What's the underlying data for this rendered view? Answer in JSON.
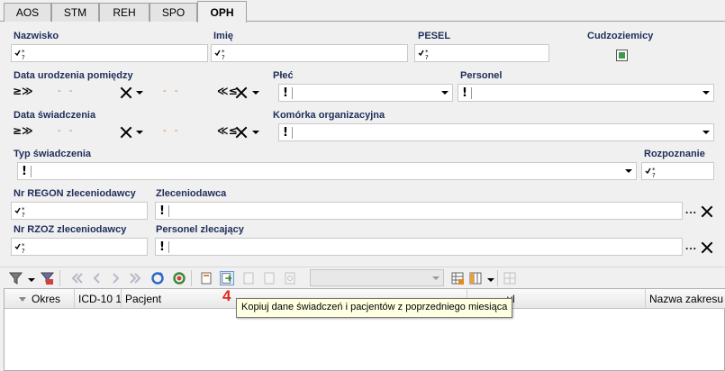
{
  "tabs": [
    {
      "label": "AOS"
    },
    {
      "label": "STM"
    },
    {
      "label": "REH"
    },
    {
      "label": "SPO"
    },
    {
      "label": "OPH"
    }
  ],
  "active_tab": "OPH",
  "form": {
    "nazwisko": {
      "label": "Nazwisko"
    },
    "imie": {
      "label": "Imię"
    },
    "pesel": {
      "label": "PESEL"
    },
    "cudzoziemcy": {
      "label": "Cudzoziemicy",
      "checked": true
    },
    "data_urodzenia": {
      "label": "Data urodzenia pomiędzy",
      "from": "- -",
      "to": "- -"
    },
    "plec": {
      "label": "Płeć"
    },
    "personel": {
      "label": "Personel"
    },
    "data_swiadczenia": {
      "label": "Data świadczenia",
      "from": "- -",
      "to": "- -"
    },
    "komorka": {
      "label": "Komórka organizacyjna"
    },
    "typ_swiadczenia": {
      "label": "Typ świadczenia"
    },
    "rozpoznanie": {
      "label": "Rozpoznanie"
    },
    "nr_regon": {
      "label": "Nr REGON zleceniodawcy"
    },
    "zleceniodawca": {
      "label": "Zleceniodawca",
      "button": "..."
    },
    "nr_rzoz": {
      "label": "Nr RZOZ zleceniodawcy"
    },
    "personel_zlecajacy": {
      "label": "Personel zlecający",
      "button": "..."
    }
  },
  "toolbar": {
    "step_number": "4",
    "tooltip": "Kopiuj dane świadczeń i pacjentów z poprzedniego miesiąca",
    "icons": [
      "filter-icon",
      "clear-filter-icon",
      "first-icon",
      "prev-icon",
      "next-icon",
      "last-icon",
      "refresh-icon",
      "sync-icon",
      "new-doc-icon",
      "copy-data-icon",
      "edit-icon",
      "delete-icon",
      "preview-icon",
      "grid-config-icon",
      "columns-icon",
      "export-icon"
    ]
  },
  "grid": {
    "columns": [
      "Okres",
      "ICD-10 1",
      "Pacjent",
      "Nazwa zakresu"
    ],
    "hidden_partial": "yl"
  },
  "colors": {
    "label": "#1f2e5a",
    "date_dash": "#e07a2c",
    "step": "#e0281e",
    "tooltip_bg": "#ffffe1"
  }
}
